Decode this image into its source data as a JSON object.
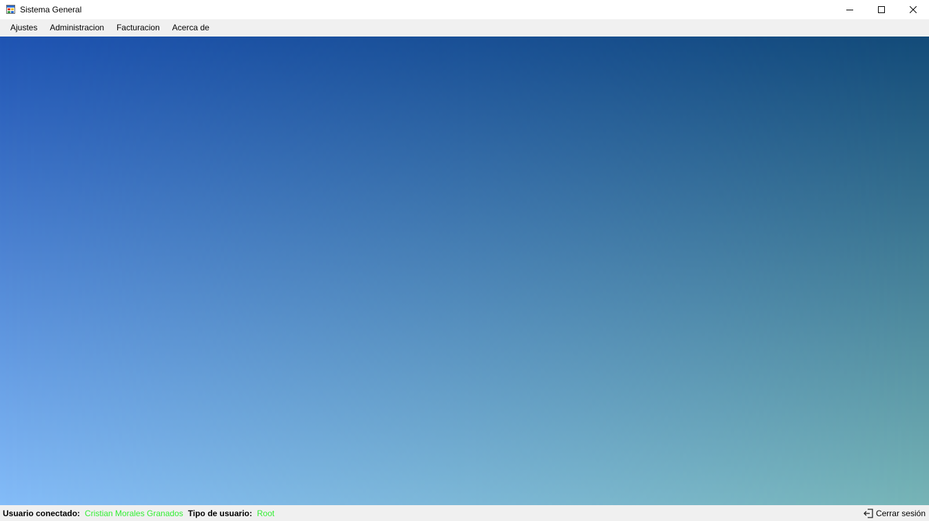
{
  "window": {
    "title": "Sistema General",
    "app_icon": "form-icon",
    "controls": [
      "minimize-icon",
      "maximize-icon",
      "close-icon"
    ]
  },
  "menu": {
    "items": [
      {
        "label": "Ajustes"
      },
      {
        "label": "Administracion"
      },
      {
        "label": "Facturacion"
      },
      {
        "label": "Acerca de"
      }
    ]
  },
  "colors": {
    "gradient_top_left": "#1f54b3",
    "gradient_top_right": "#134b78",
    "gradient_bottom_left": "#84bcf8",
    "gradient_bottom_right": "#76b4b6",
    "status_value": "#33ee33"
  },
  "status": {
    "user_label": "Usuario conectado:",
    "user_value": "Cristian Morales Granados",
    "type_label": "Tipo de usuario:",
    "type_value": "Root",
    "logout_label": "Cerrar sesión",
    "logout_icon": "logout-icon"
  }
}
